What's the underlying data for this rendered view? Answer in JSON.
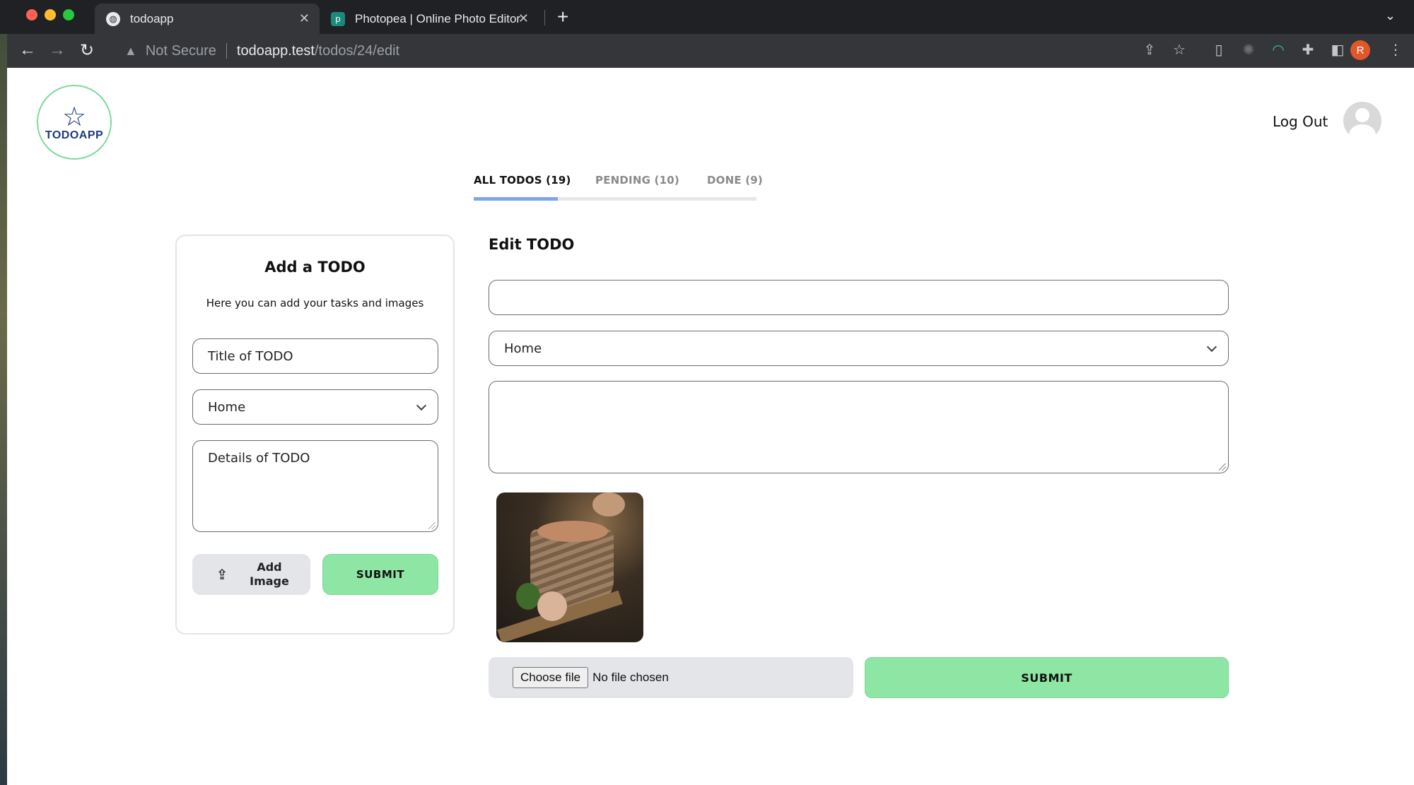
{
  "browser": {
    "tabs": [
      {
        "title": "todoapp",
        "icon": "globe-icon",
        "active": true
      },
      {
        "title": "Photopea | Online Photo Editor",
        "icon": "photopea-icon",
        "active": false
      }
    ],
    "address": {
      "security": "Not Secure",
      "host": "todoapp.test",
      "path": "/todos/24/edit"
    },
    "profile_initial": "R"
  },
  "header": {
    "logo_text": "TODOAPP",
    "logout_label": "Log Out"
  },
  "nav_tabs": [
    {
      "label": "ALL TODOS (19)",
      "active": true
    },
    {
      "label": "PENDING (10)",
      "active": false
    },
    {
      "label": "DONE (9)",
      "active": false
    }
  ],
  "add_form": {
    "title": "Add a TODO",
    "subtitle": "Here you can add your tasks and images",
    "title_placeholder": "Title of TODO",
    "category_value": "Home",
    "details_placeholder": "Details of TODO",
    "add_image_label": "Add Image",
    "submit_label": "SUBMIT"
  },
  "edit_form": {
    "heading": "Edit TODO",
    "title_value": "",
    "category_value": "Home",
    "details_value": "",
    "file_button_label": "Choose file",
    "file_status": "No file chosen",
    "submit_label": "SUBMIT"
  },
  "colors": {
    "accent_green": "#8ee6a5",
    "tab_indicator": "#7ea6e8",
    "logo_blue": "#1d3a7a"
  }
}
